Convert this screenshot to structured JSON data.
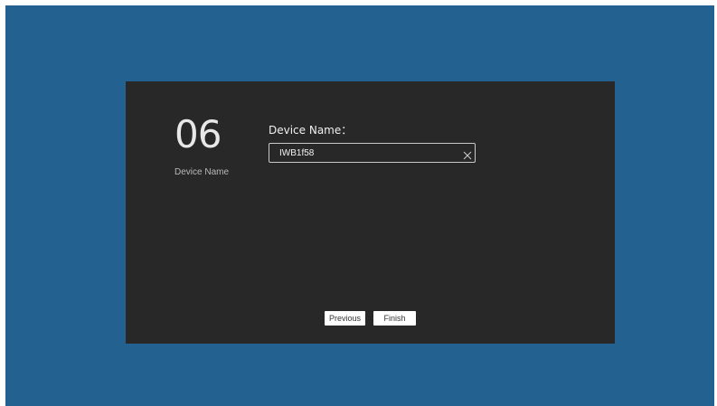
{
  "wizard": {
    "step_number": "06",
    "step_caption": "Device Name"
  },
  "form": {
    "label": "Device Name：",
    "device_name_value": "IWB1f58",
    "clear_icon": "close-icon"
  },
  "buttons": {
    "previous": "Previous",
    "finish": "Finish"
  },
  "colors": {
    "background": "#236190",
    "panel": "#282828",
    "text": "#f0f0f0",
    "button": "#ffffff"
  }
}
